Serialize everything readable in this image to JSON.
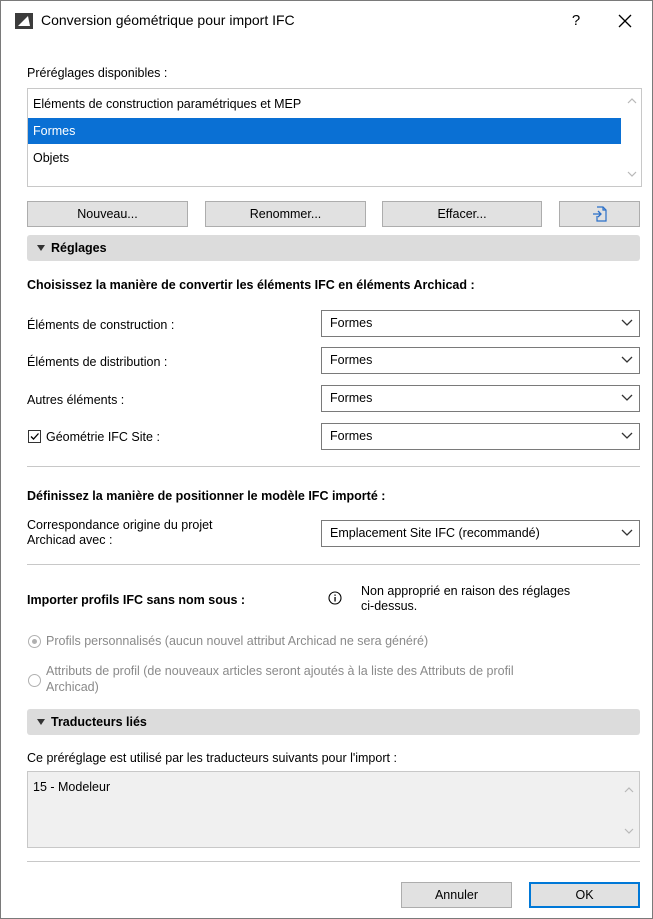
{
  "window": {
    "title": "Conversion géométrique pour import IFC",
    "help_label": "?",
    "close_label": "✕"
  },
  "presets": {
    "label": "Préréglages disponibles :",
    "items": [
      "Eléments de construction paramétriques et MEP",
      "Formes",
      "Objets"
    ],
    "selected_index": 1,
    "buttons": {
      "new": "Nouveau...",
      "rename": "Renommer...",
      "delete": "Effacer..."
    }
  },
  "settings": {
    "header": "Réglages",
    "convert_heading": "Choisissez la manière de convertir les éléments IFC en éléments Archicad :",
    "rows": [
      {
        "label": "Éléments de construction :",
        "value": "Formes"
      },
      {
        "label": "Éléments de distribution :",
        "value": "Formes"
      },
      {
        "label": "Autres éléments :",
        "value": "Formes"
      },
      {
        "label": "Géométrie IFC Site :",
        "value": "Formes",
        "checked": true
      }
    ],
    "position_heading": "Définissez la manière de positionner le modèle IFC importé :",
    "origin_label_1": "Correspondance origine du projet",
    "origin_label_2": "Archicad avec :",
    "origin_value": "Emplacement Site IFC (recommandé)",
    "profiles_label": "Importer profils IFC sans nom sous :",
    "info_text_1": "Non approprié en raison des réglages",
    "info_text_2": "ci-dessus.",
    "radio_custom": "Profils personnalisés (aucun nouvel attribut Archicad ne sera généré)",
    "radio_attr_1": "Attributs de profil (de nouveaux articles seront ajoutés à la liste des Attributs de profil",
    "radio_attr_2": "Archicad)"
  },
  "translators": {
    "header": "Traducteurs liés",
    "description": "Ce préréglage est utilisé par les traducteurs suivants pour l'import :",
    "items": [
      "15 - Modeleur"
    ]
  },
  "footer": {
    "cancel": "Annuler",
    "ok": "OK"
  }
}
